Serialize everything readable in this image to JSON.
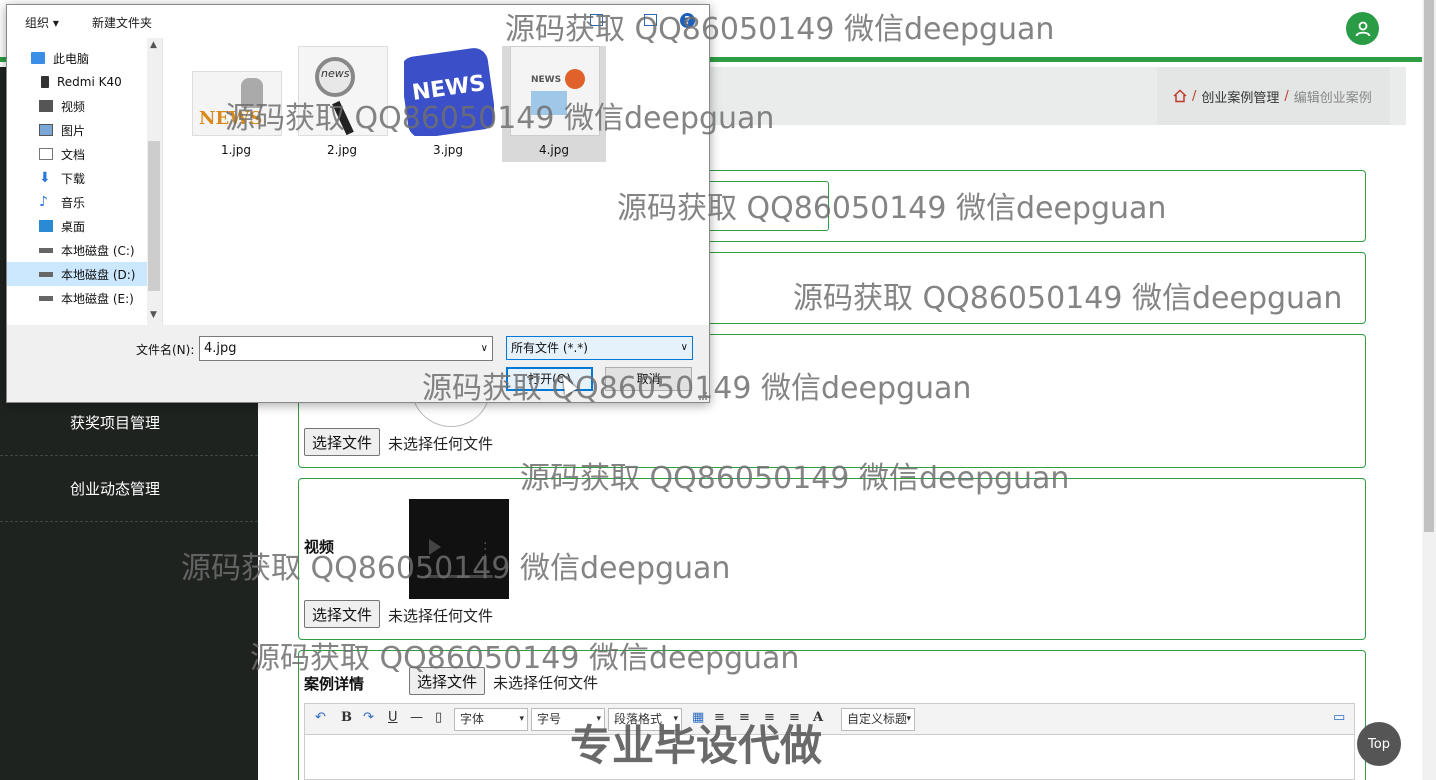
{
  "sidebar": {
    "items": [
      {
        "label": "获奖项目管理"
      },
      {
        "label": "创业动态管理"
      }
    ]
  },
  "breadcrumb": {
    "items": [
      "创业案例管理",
      "编辑创业案例"
    ],
    "separator": "/"
  },
  "form": {
    "image_field": {
      "button": "选择文件",
      "status": "未选择任何文件"
    },
    "video_field": {
      "label": "视频",
      "button": "选择文件",
      "status": "未选择任何文件"
    },
    "detail_field": {
      "label": "案例详情",
      "button": "选择文件",
      "status": "未选择任何文件"
    },
    "editor_toolbar": {
      "bold": "B",
      "underline": "U",
      "hr": "—",
      "font_select": "字体",
      "size_select": "字号",
      "paragraph_select": "段落格式",
      "text_color": "A",
      "custom_title_select": "自定义标题"
    }
  },
  "top_button": "Top",
  "dialog": {
    "toolbar": {
      "organize": "组织 ▾",
      "new_folder": "新建文件夹",
      "help": "?"
    },
    "nav_items": [
      {
        "label": "此电脑",
        "icon": "computer-icon"
      },
      {
        "label": "Redmi K40",
        "icon": "phone-icon"
      },
      {
        "label": "视频",
        "icon": "video-folder-icon"
      },
      {
        "label": "图片",
        "icon": "pictures-folder-icon"
      },
      {
        "label": "文档",
        "icon": "documents-folder-icon"
      },
      {
        "label": "下载",
        "icon": "download-icon"
      },
      {
        "label": "音乐",
        "icon": "music-icon"
      },
      {
        "label": "桌面",
        "icon": "desktop-icon"
      },
      {
        "label": "本地磁盘 (C:)",
        "icon": "drive-icon"
      },
      {
        "label": "本地磁盘 (D:)",
        "icon": "drive-icon",
        "selected": true
      },
      {
        "label": "本地磁盘 (E:)",
        "icon": "drive-icon"
      }
    ],
    "files": [
      {
        "name": "1.jpg"
      },
      {
        "name": "2.jpg",
        "thumb_text": "news"
      },
      {
        "name": "3.jpg",
        "thumb_text": "NEWS"
      },
      {
        "name": "4.jpg",
        "thumb_text": "NEWS",
        "selected": true
      }
    ],
    "file_thumb_1_text": "NEWS",
    "filename_label": "文件名(N):",
    "filename_value": "4.jpg",
    "filetype_value": "所有文件 (*.*)",
    "open_button": "打开(O)",
    "cancel_button": "取消"
  },
  "watermarks": [
    "源码获取 QQ86050149 微信deepguan",
    "源码获取 QQ86050149 微信deepguan",
    "源码获取 QQ86050149 微信deepguan",
    "源码获取 QQ86050149 微信deepguan",
    "源码获取 QQ86050149 微信deepguan",
    "源码获取 QQ86050149 微信deepguan",
    "源码获取 QQ86050149 微信deepguan",
    "源码获取 QQ86050149 微信deepguan"
  ],
  "watermark_big": "专业毕设代做",
  "colors": {
    "accent": "#2e9e45",
    "sidebar_bg": "#1f2320",
    "dialog_accent": "#0078d7"
  }
}
